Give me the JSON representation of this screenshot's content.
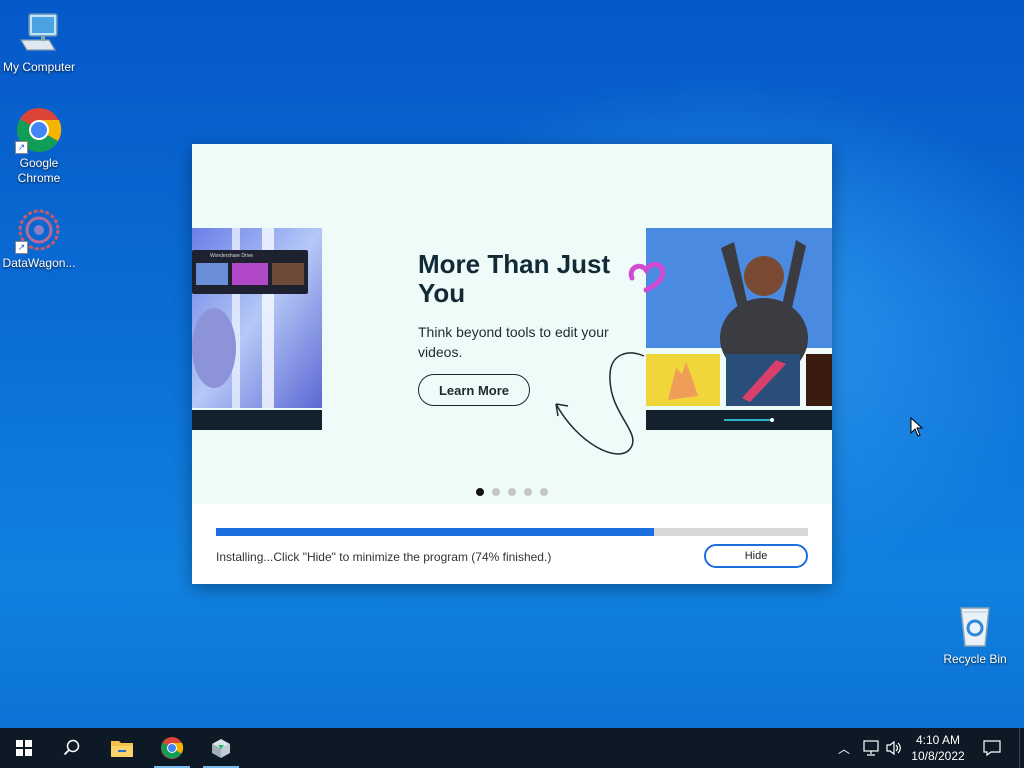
{
  "desktop": {
    "icons": [
      {
        "label": "My Computer"
      },
      {
        "label": "Google Chrome"
      },
      {
        "label": "DataWagon..."
      },
      {
        "label": "Recycle Bin"
      }
    ]
  },
  "installer": {
    "headline": "More Than Just You",
    "subtext": "Think beyond tools to edit your videos.",
    "learn_more_label": "Learn More",
    "preview_window_title": "Wondershare Drive",
    "carousel_dots": 5,
    "carousel_active_index": 0,
    "progress_fraction": 0.74,
    "status_text": "Installing...Click \"Hide\" to minimize the program (74% finished.)",
    "hide_label": "Hide"
  },
  "taskbar": {
    "pinned": [
      "start-icon",
      "search-icon",
      "file-explorer-icon",
      "chrome-icon",
      "installer-icon"
    ],
    "clock_time": "4:10 AM",
    "clock_date": "10/8/2022"
  },
  "colors": {
    "accent": "#1a6fe0",
    "window_bg": "#eefbf8",
    "taskbar_bg": "#0d1a26"
  }
}
